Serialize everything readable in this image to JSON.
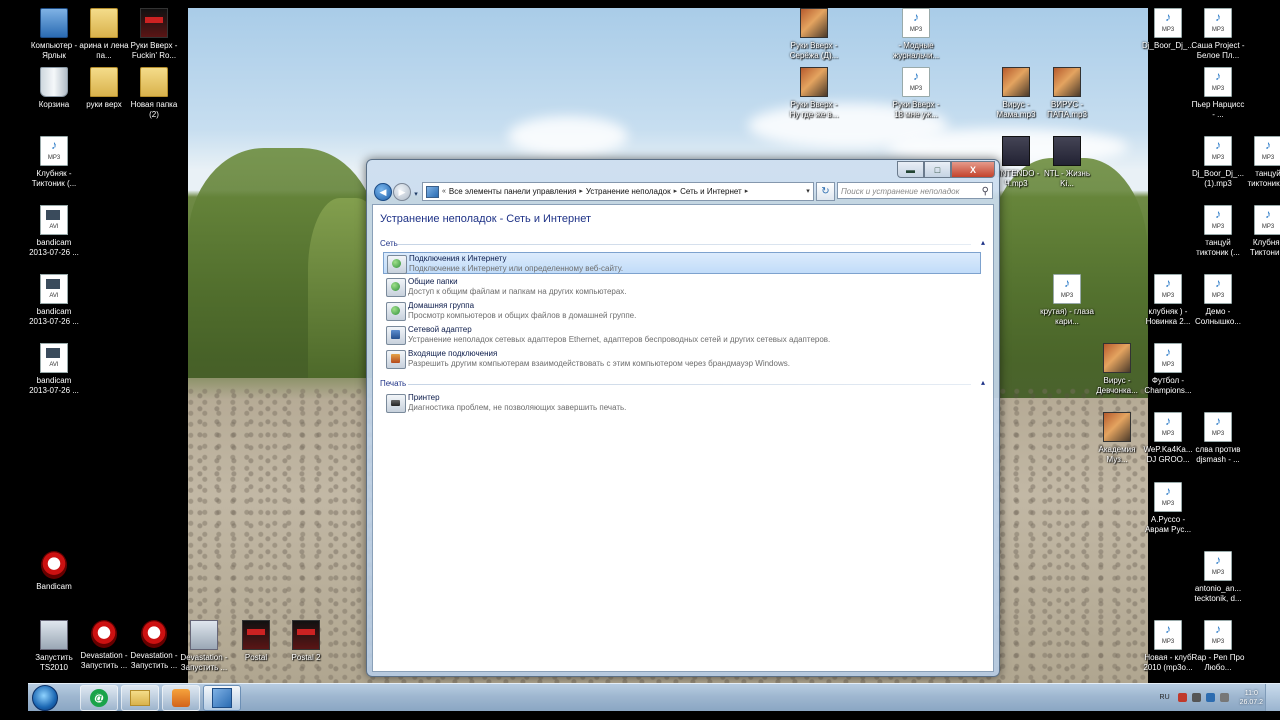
{
  "desktop_icons": [
    {
      "label": "Компьютер - Ярлык",
      "type": "pc"
    },
    {
      "label": "арина и лена па...",
      "type": "folder"
    },
    {
      "label": "Руки Вверх - Fuckin' Ro...",
      "type": "game"
    },
    {
      "label": "Корзина",
      "type": "bin"
    },
    {
      "label": "руки верх",
      "type": "folder"
    },
    {
      "label": "Новая папка (2)",
      "type": "folder"
    },
    {
      "label": "Клубняк - Тиктоник (...",
      "type": "mp3"
    },
    {
      "label": "bandicam 2013-07-26 ...",
      "type": "avi"
    },
    {
      "label": "bandicam 2013-07-26 ...",
      "type": "avi"
    },
    {
      "label": "bandicam 2013-07-26 ...",
      "type": "avi"
    },
    {
      "label": "Bandicam",
      "type": "red"
    },
    {
      "label": "Запустить TS2010",
      "type": "gray"
    },
    {
      "label": "Devastation - Запустить ...",
      "type": "red"
    },
    {
      "label": "Devastation - Запустить ...",
      "type": "red"
    },
    {
      "label": "Devastation - Запустить ...",
      "type": "gray"
    },
    {
      "label": "Postal",
      "type": "game"
    },
    {
      "label": "Postal 2",
      "type": "game"
    },
    {
      "label": "Руки Вверх - Серёжа (Д)...",
      "type": "photo"
    },
    {
      "label": "- Модные журнальчи...",
      "type": "mp3"
    },
    {
      "label": "Руки Вверх - Ну где же в...",
      "type": "photo"
    },
    {
      "label": "Руки Вверх - 18 мне уж...",
      "type": "mp3"
    },
    {
      "label": "Вирус - Мама.mp3",
      "type": "photo"
    },
    {
      "label": "ВИРУС - ПАПА.mp3",
      "type": "photo"
    },
    {
      "label": "NINTENDO - Ч.mp3",
      "type": "dark"
    },
    {
      "label": "NTL - Жизнь Ki...",
      "type": "dark"
    },
    {
      "label": "Dj_Boor_Dj_...",
      "type": "mp3"
    },
    {
      "label": "Саша Project - Белое Пл...",
      "type": "mp3"
    },
    {
      "label": "Пьер Нарцисс - ...",
      "type": "mp3"
    },
    {
      "label": "Dj_Boor_Dj_... (1).mp3",
      "type": "mp3"
    },
    {
      "label": "танцуй тиктоник ...",
      "type": "mp3"
    },
    {
      "label": "танцуй тиктоник (...",
      "type": "mp3"
    },
    {
      "label": "Клубняк Тиктони...",
      "type": "mp3"
    },
    {
      "label": "крутая) - глаза кари...",
      "type": "mp3"
    },
    {
      "label": "клубняк ) - Новинка 2...",
      "type": "mp3"
    },
    {
      "label": "Демо - Солнышко...",
      "type": "mp3"
    },
    {
      "label": "Вирус - Девчонка...",
      "type": "photo"
    },
    {
      "label": "Футбол - Champions...",
      "type": "mp3"
    },
    {
      "label": "Академия Муз...",
      "type": "photo"
    },
    {
      "label": "WeP.Ka4Ka... DJ GROO...",
      "type": "mp3"
    },
    {
      "label": "слва против djsmash - ...",
      "type": "mp3"
    },
    {
      "label": "А.Руссо - Аврам Рус...",
      "type": "mp3"
    },
    {
      "label": "antonio_an... tecktonik, d...",
      "type": "mp3"
    },
    {
      "label": "Новая - клуб 2010 (mp3o...",
      "type": "mp3"
    },
    {
      "label": "Rap - Pen Про Любо...",
      "type": "mp3"
    }
  ],
  "window": {
    "controls": {
      "minimize": "▬",
      "maximize": "□",
      "close": "X"
    },
    "nav": {
      "back": "◀",
      "forward": "▶",
      "history": "▾"
    },
    "address": {
      "overflow": "«",
      "crumbs": [
        "Все элементы панели управления",
        "Устранение неполадок",
        "Сеть и Интернет"
      ],
      "separator": "▸",
      "dropdown": "▾"
    },
    "refresh": "↻",
    "search_placeholder": "Поиск и устранение неполадок",
    "search_icon": "⚲",
    "page_title": "Устранение неполадок - Сеть и Интернет",
    "sections": [
      {
        "title": "Сеть",
        "collapse": "▴",
        "items": [
          {
            "title": "Подключения к Интернету",
            "desc": "Подключение к Интернету или определенному веб-сайту.",
            "icon": "internet-connections-icon"
          },
          {
            "title": "Общие папки",
            "desc": "Доступ к общим файлам и папкам на других компьютерах.",
            "icon": "shared-folders-icon"
          },
          {
            "title": "Домашняя группа",
            "desc": "Просмотр компьютеров и общих файлов в домашней группе.",
            "icon": "homegroup-icon"
          },
          {
            "title": "Сетевой адаптер",
            "desc": "Устранение неполадок сетевых адаптеров Ethernet, адаптеров беспроводных сетей и других сетевых адаптеров.",
            "icon": "network-adapter-icon"
          },
          {
            "title": "Входящие подключения",
            "desc": "Разрешить другим компьютерам взаимодействовать с этим компьютером через брандмауэр Windows.",
            "icon": "incoming-connections-icon"
          }
        ]
      },
      {
        "title": "Печать",
        "collapse": "▴",
        "items": [
          {
            "title": "Принтер",
            "desc": "Диагностика проблем, не позволяющих завершить печать.",
            "icon": "printer-icon"
          }
        ]
      }
    ]
  },
  "taskbar": {
    "mail_glyph": "@",
    "tray": {
      "lang": "RU",
      "time": "11:0",
      "date": "26.07.2"
    }
  }
}
